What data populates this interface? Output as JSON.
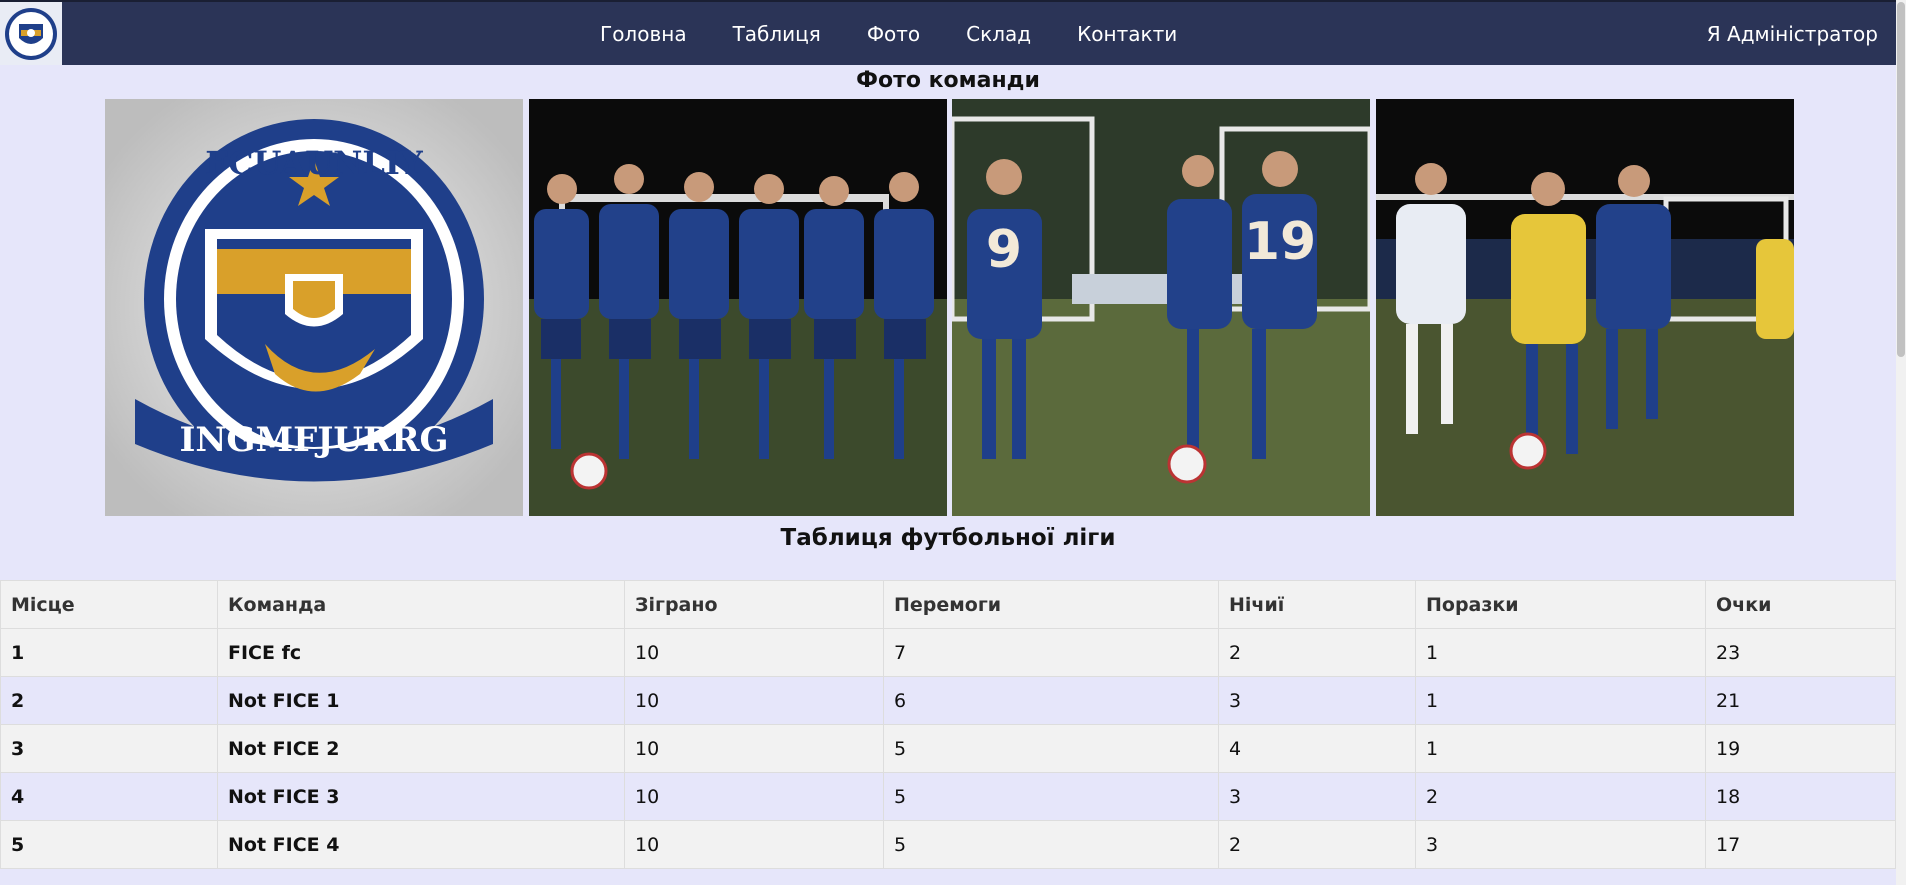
{
  "nav": {
    "items": [
      "Головна",
      "Таблиця",
      "Фото",
      "Склад",
      "Контакти"
    ],
    "user": "Я Адміністратор"
  },
  "photos": {
    "title": "Фото команди",
    "items": [
      {
        "name": "club-crest",
        "crest_top": "FCUAUNLIY",
        "crest_bottom": "INGMFJURRG"
      },
      {
        "name": "team-lineup"
      },
      {
        "name": "players-celebrating",
        "numbers": [
          "9",
          "19"
        ]
      },
      {
        "name": "match-action"
      }
    ]
  },
  "league": {
    "title": "Таблиця футбольної ліги",
    "columns": [
      "Місце",
      "Команда",
      "Зіграно",
      "Перемоги",
      "Нічиї",
      "Поразки",
      "Очки"
    ],
    "rows": [
      [
        "1",
        "FICE fc",
        "10",
        "7",
        "2",
        "1",
        "23"
      ],
      [
        "2",
        "Not FICE 1",
        "10",
        "6",
        "3",
        "1",
        "21"
      ],
      [
        "3",
        "Not FICE 2",
        "10",
        "5",
        "4",
        "1",
        "19"
      ],
      [
        "4",
        "Not FICE 3",
        "10",
        "5",
        "3",
        "2",
        "18"
      ],
      [
        "5",
        "Not FICE 4",
        "10",
        "5",
        "2",
        "3",
        "17"
      ]
    ]
  },
  "colors": {
    "navbar": "#2b3457",
    "page_bg": "#e6e6fa",
    "row_alt": "#f2f2f2",
    "crest_blue": "#1f3f8a",
    "crest_gold": "#d9a02a"
  }
}
